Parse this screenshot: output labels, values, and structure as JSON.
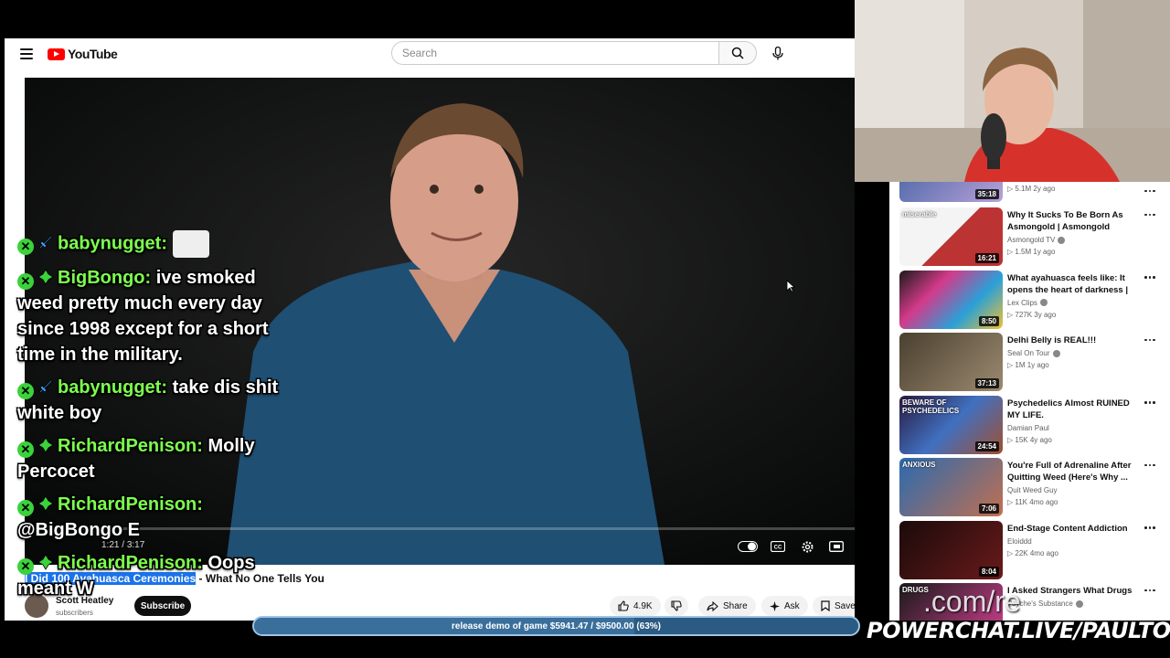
{
  "header": {
    "logo_text": "YouTube",
    "search_placeholder": "Search"
  },
  "player": {
    "time_current": "1:21",
    "time_total": "3:17",
    "progress_fraction": 0.067
  },
  "video": {
    "title_highlighted": "I Did 100 Ayahuasca Ceremonies",
    "title_rest": " - What No One Tells You",
    "channel": "Scott Heatley",
    "subscribers": "subscribers",
    "subscribe_label": "Subscribe",
    "likes": "4.9K",
    "share_label": "Share",
    "ask_label": "Ask",
    "save_label": "Save"
  },
  "sidebar": {
    "top_partial": {
      "duration": "35:18",
      "meta": "▷ 5.1M  2y ago"
    },
    "items": [
      {
        "title": "Why It Sucks To Be Born As Asmongold | Asmongold Reacts",
        "channel": "Asmongold TV",
        "verified": true,
        "meta": "▷ 1.5M  1y ago",
        "duration": "16:21",
        "thumb_text": "miserable"
      },
      {
        "title": "What ayahuasca feels like: It opens the heart of darkness | ...",
        "channel": "Lex Clips",
        "verified": true,
        "meta": "▷ 727K  3y ago",
        "duration": "8:50",
        "thumb_text": ""
      },
      {
        "title": "Delhi Belly is REAL!!!",
        "channel": "Seal On Tour",
        "verified": true,
        "meta": "▷ 1M  1y ago",
        "duration": "37:13",
        "thumb_text": ""
      },
      {
        "title": "Psychedelics Almost RUINED MY LIFE.",
        "channel": "Damian Paul",
        "verified": false,
        "meta": "▷ 15K  4y ago",
        "duration": "24:54",
        "thumb_text": "BEWARE OF PSYCHEDELICS"
      },
      {
        "title": "You're Full of Adrenaline After Quitting Weed (Here's Why ...",
        "channel": "Quit Weed Guy",
        "verified": false,
        "meta": "▷ 11K  4mo ago",
        "duration": "7:06",
        "thumb_text": "ANXIOUS"
      },
      {
        "title": "End-Stage Content Addiction",
        "channel": "Eloiddd",
        "verified": false,
        "meta": "▷ 22K  4mo ago",
        "duration": "8:04",
        "thumb_text": ""
      },
      {
        "title": "I Asked Strangers What Drugs",
        "channel": "Psyche's Substance",
        "verified": true,
        "meta": "",
        "duration": "",
        "thumb_text": "DRUGS"
      }
    ]
  },
  "chat": [
    {
      "user": "babynugget:",
      "badge": "sword",
      "text": ""
    },
    {
      "user": "BigBongo:",
      "badge": "diamond",
      "text": "ive smoked weed pretty much every day since 1998 except for a short time in the military."
    },
    {
      "user": "babynugget:",
      "badge": "sword",
      "text": "take dis shit white boy"
    },
    {
      "user": "RichardPenison:",
      "badge": "diamond",
      "text": "Molly Percocet"
    },
    {
      "user": "RichardPenison:",
      "badge": "diamond",
      "text": "@BigBongo E"
    },
    {
      "user": "RichardPenison:",
      "badge": "diamond",
      "text": "Oops meant W"
    }
  ],
  "stream": {
    "donation_text": "release demo of game $5941.47 / $9500.00 (63%)",
    "donation_fraction": 0.63,
    "powerchat": "POWERCHAT.LIVE/PAULTOWN",
    "url_ghost": ".com/re"
  },
  "colors": {
    "youtube_red": "#ff0000",
    "chat_user": "#7dff4d",
    "donation_bar": "#2b5a82"
  }
}
